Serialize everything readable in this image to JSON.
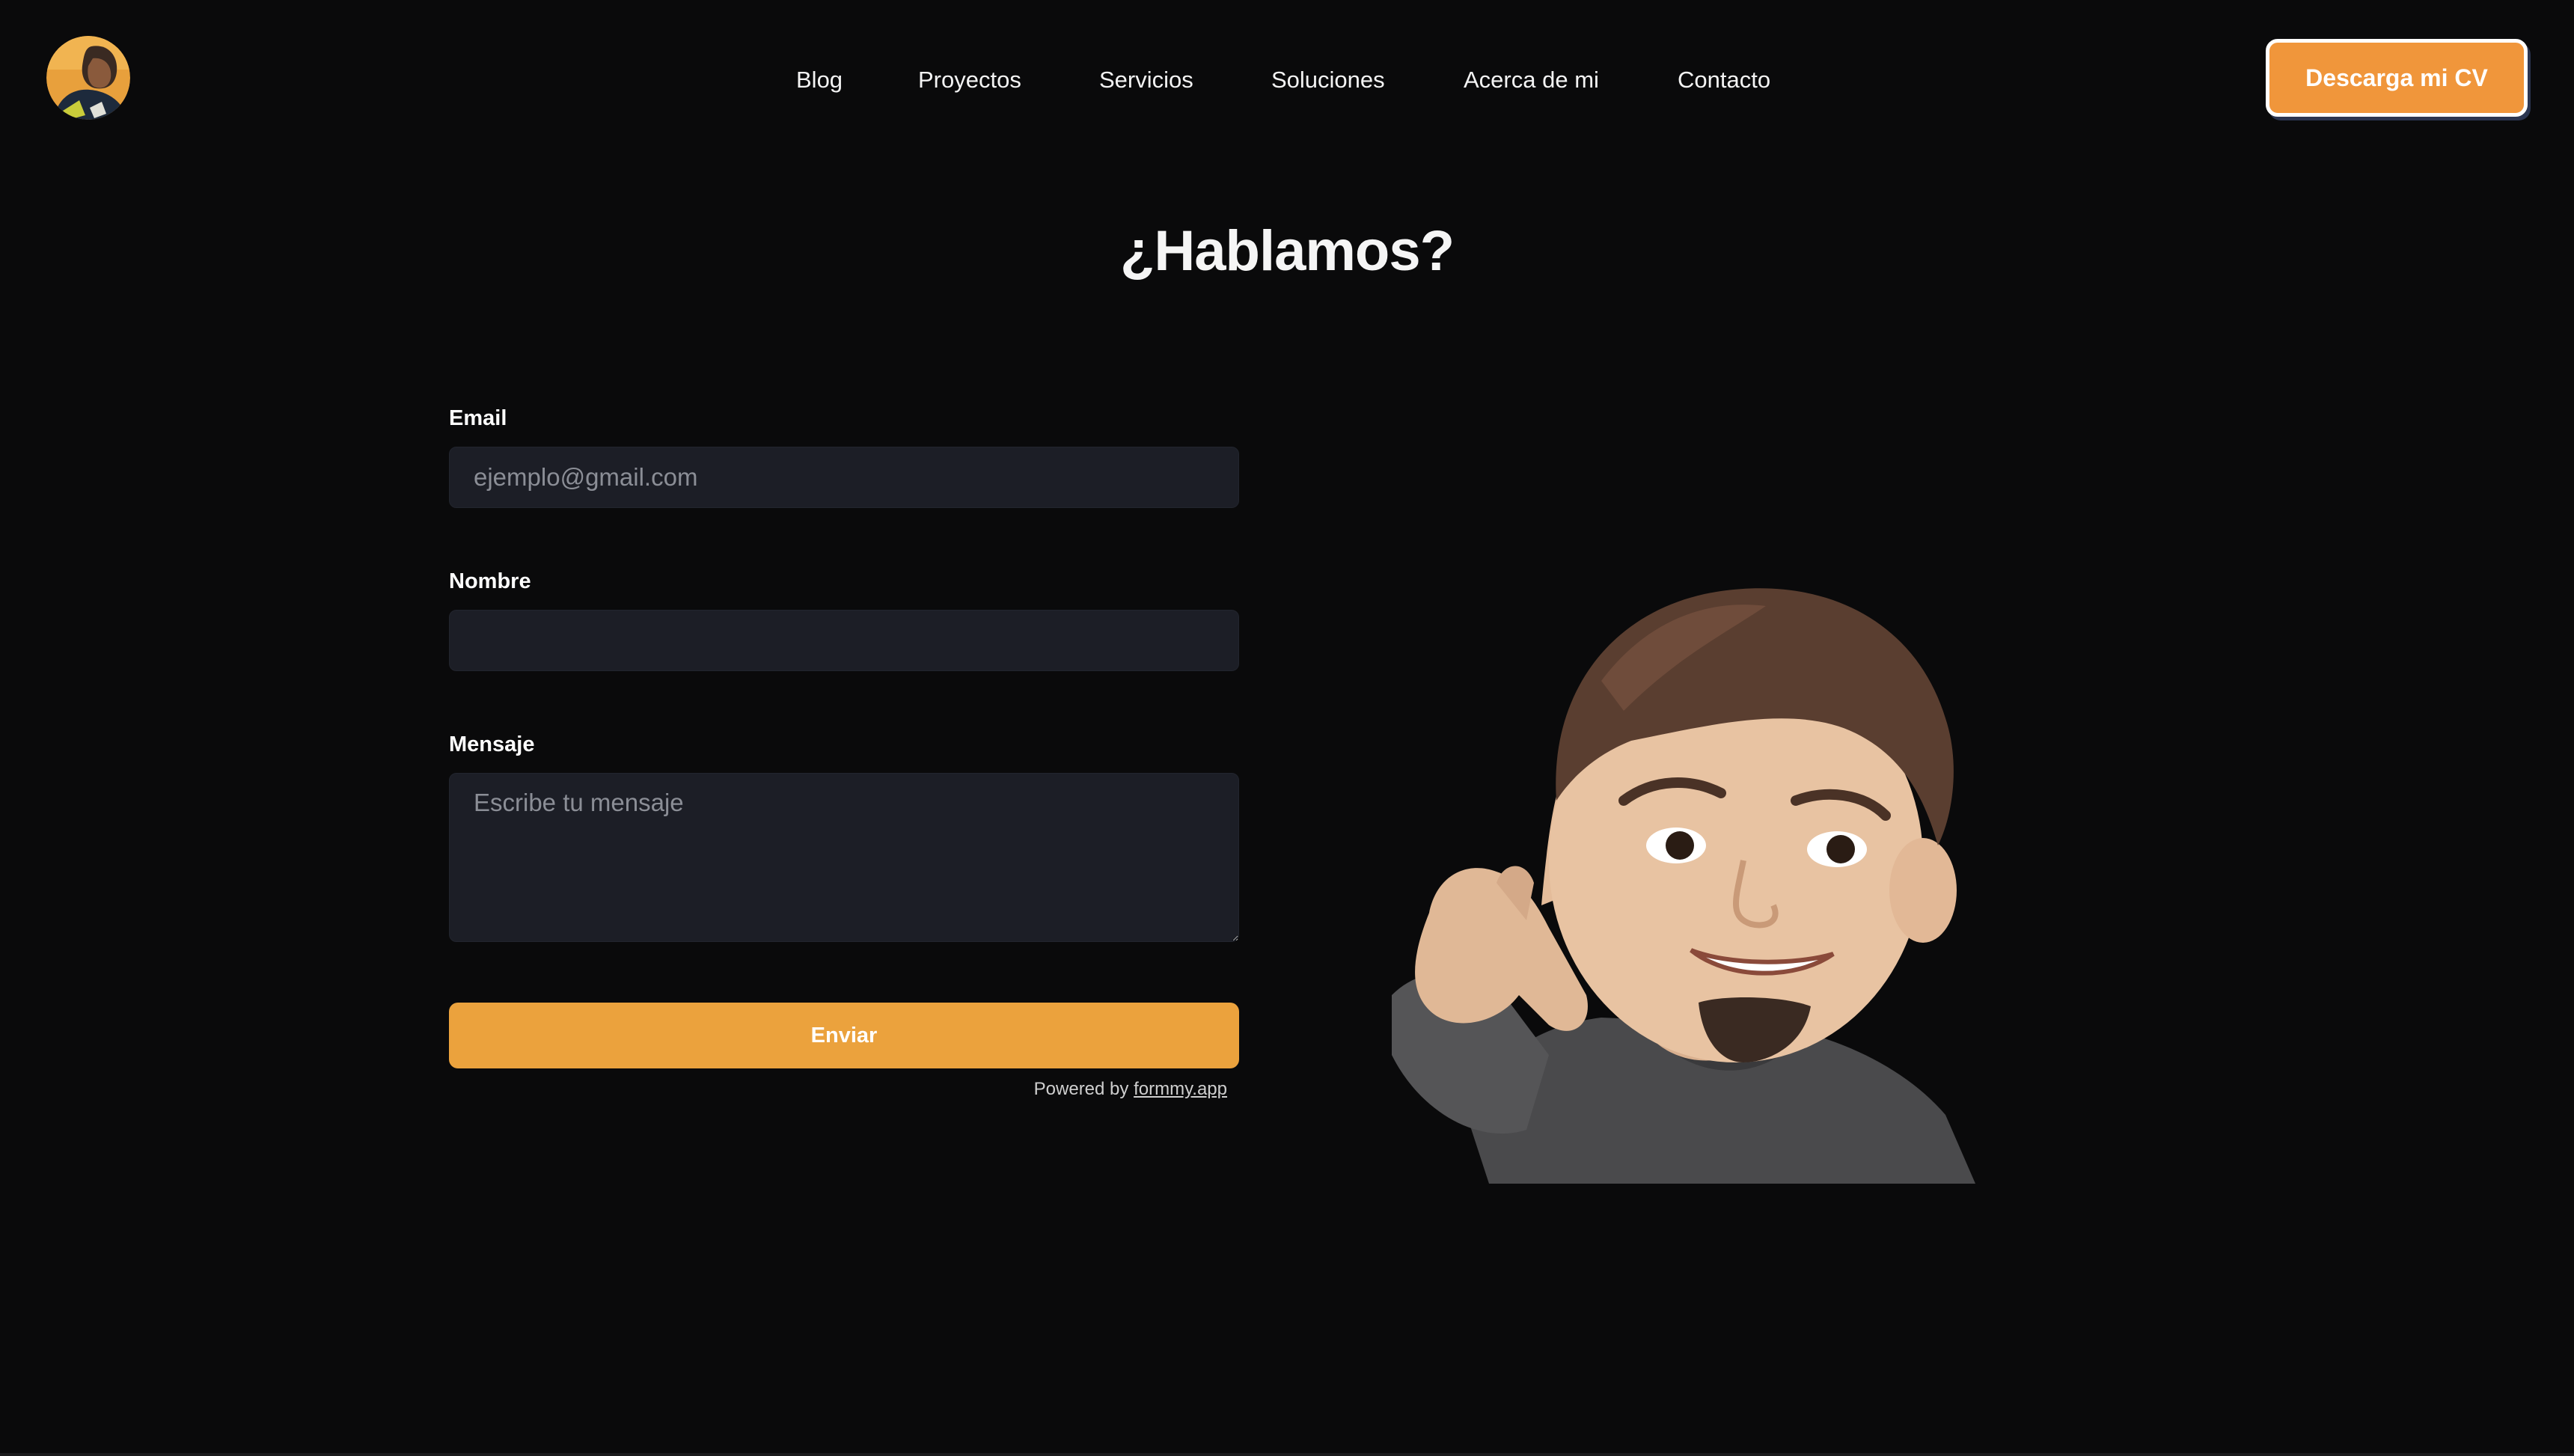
{
  "header": {
    "avatar_alt": "profile photo",
    "nav": [
      "Blog",
      "Proyectos",
      "Servicios",
      "Soluciones",
      "Acerca de mi",
      "Contacto"
    ],
    "cv_button": "Descarga mi CV"
  },
  "main": {
    "title": "¿Hablamos?",
    "form": {
      "email_label": "Email",
      "email_placeholder": "ejemplo@gmail.com",
      "email_value": "",
      "name_label": "Nombre",
      "name_value": "",
      "message_label": "Mensaje",
      "message_placeholder": "Escribe tu mensaje",
      "message_value": "",
      "submit_label": "Enviar",
      "powered_prefix": "Powered by",
      "powered_link": "formmy.app"
    }
  },
  "colors": {
    "background": "#0a0a0b",
    "accent": "#f0963b",
    "submit": "#eba23d",
    "field": "#1c1e26"
  }
}
